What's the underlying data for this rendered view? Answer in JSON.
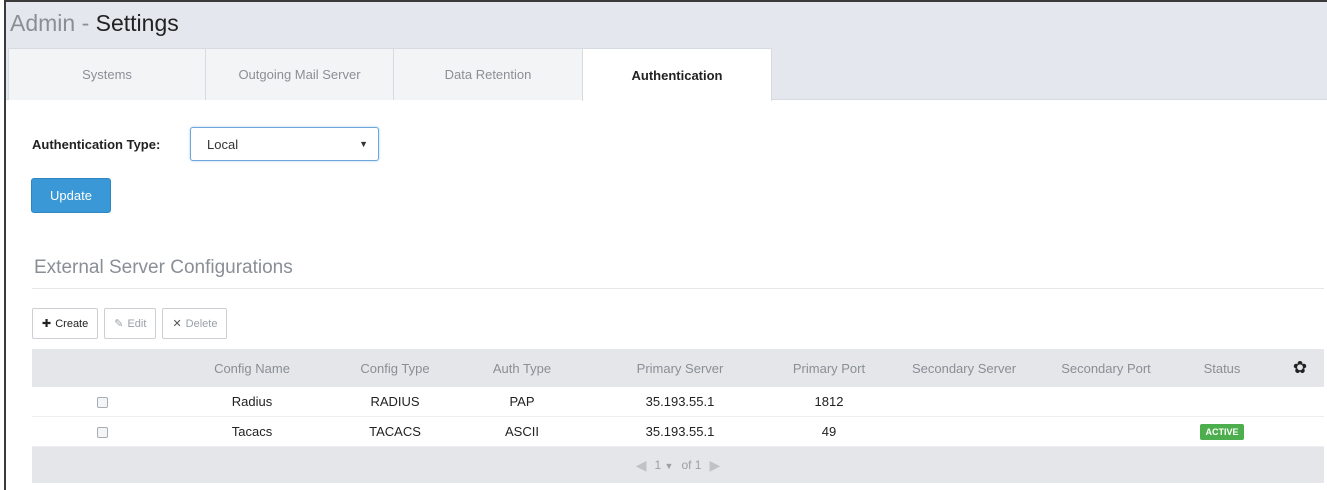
{
  "header": {
    "title_prefix": "Admin - ",
    "title_main": "Settings"
  },
  "tabs": [
    {
      "label": "Systems",
      "active": false
    },
    {
      "label": "Outgoing Mail Server",
      "active": false
    },
    {
      "label": "Data Retention",
      "active": false
    },
    {
      "label": "Authentication",
      "active": true
    }
  ],
  "auth": {
    "label": "Authentication Type:",
    "selected": "Local",
    "caret": "▼"
  },
  "update_button": "Update",
  "section": {
    "title": "External Server Configurations"
  },
  "toolbar": {
    "create": "Create",
    "edit": "Edit",
    "delete": "Delete"
  },
  "table": {
    "headers": [
      "Config Name",
      "Config Type",
      "Auth Type",
      "Primary Server",
      "Primary Port",
      "Secondary Server",
      "Secondary Port",
      "Status"
    ],
    "rows": [
      {
        "name": "Radius",
        "type": "RADIUS",
        "auth": "PAP",
        "pserver": "35.193.55.1",
        "pport": "1812",
        "sserver": "",
        "sport": "",
        "status": ""
      },
      {
        "name": "Tacacs",
        "type": "TACACS",
        "auth": "ASCII",
        "pserver": "35.193.55.1",
        "pport": "49",
        "sserver": "",
        "sport": "",
        "status": "ACTIVE"
      }
    ]
  },
  "pager": {
    "page": "1",
    "caret": "▼",
    "of": "of 1"
  },
  "colors": {
    "accent": "#3a98d6",
    "status_active": "#4cae4c",
    "header_bg": "#e4e8ee"
  },
  "icons": {
    "create": "plus-icon",
    "edit": "pencil-icon",
    "delete": "x-icon",
    "settings": "gear-icon",
    "prev": "prev-page-icon",
    "next": "next-page-icon"
  }
}
